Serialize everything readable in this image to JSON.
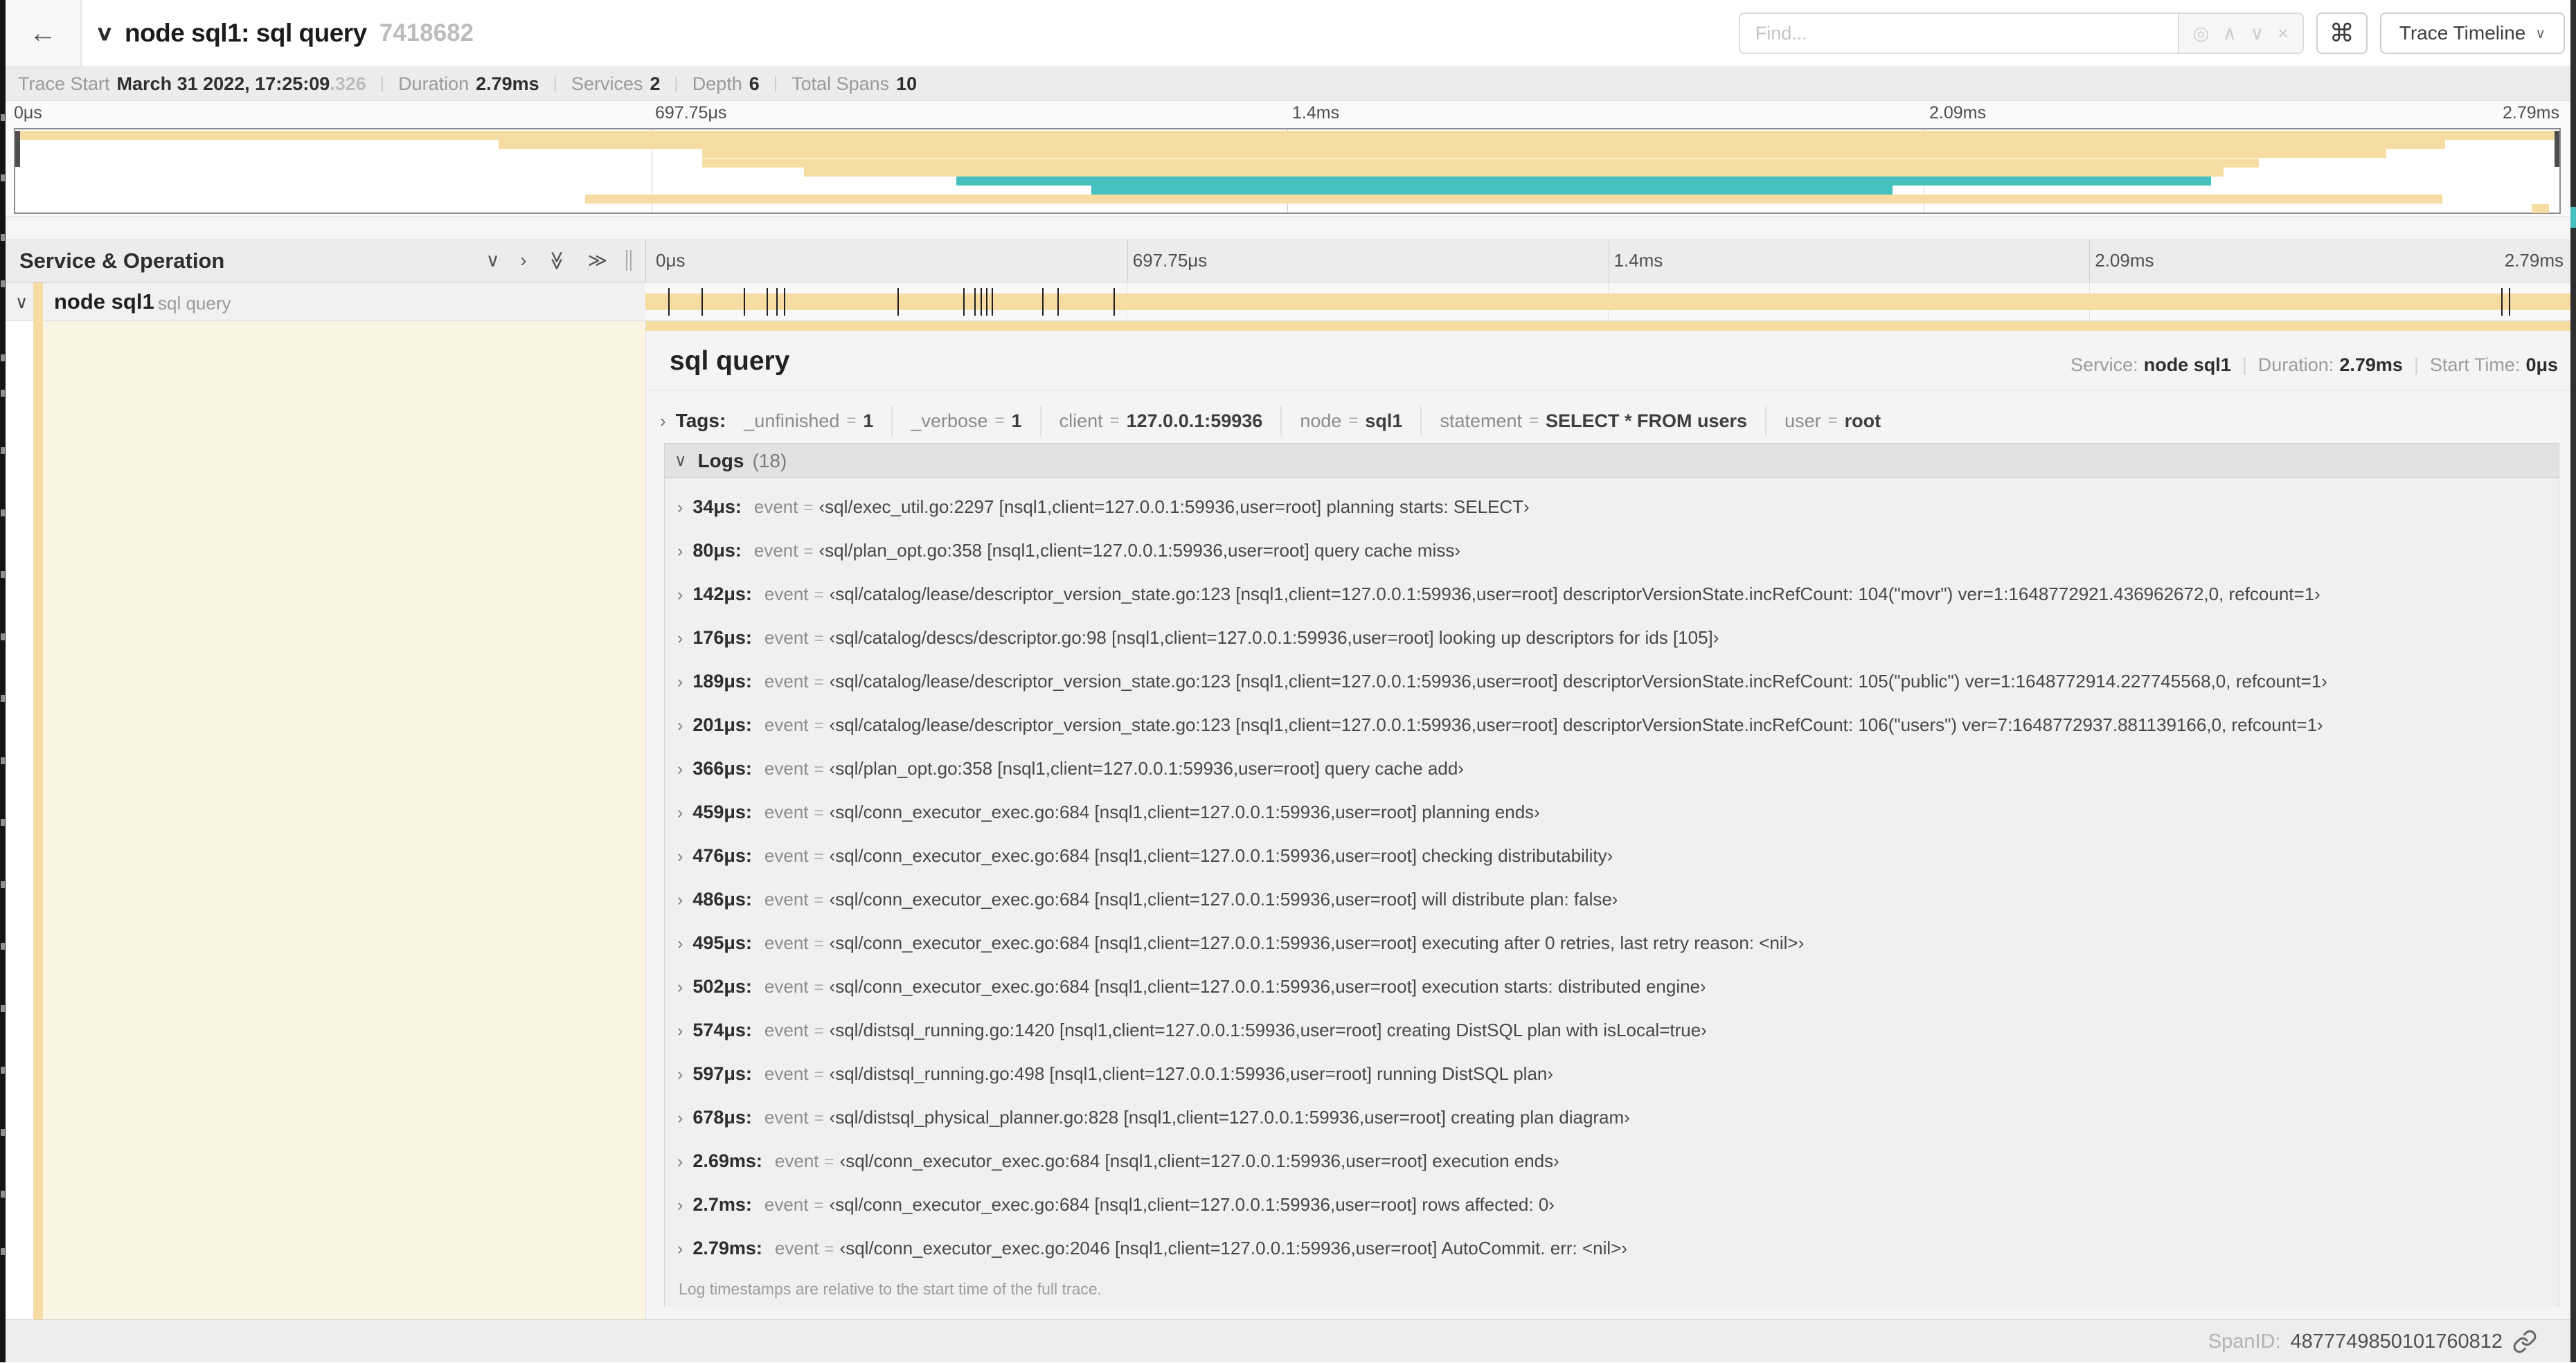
{
  "colors": {
    "span_tan": "#f6dca2",
    "span_teal": "#45bfbf",
    "detail_cream": "#fbf4e2",
    "tick_black": "#1f1f1f"
  },
  "header": {
    "back_label": "←",
    "collapse_caret": "∨",
    "title": "node sql1: sql query",
    "trace_id": "7418682",
    "find_placeholder": "Find...",
    "find_buttons": {
      "scope": "◎",
      "prev": "∧",
      "next": "∨",
      "clear": "×"
    },
    "shortcut_button": "⌘",
    "view_button_label": "Trace Timeline",
    "view_button_caret": "∨"
  },
  "trace_info": {
    "trace_start_label": "Trace Start",
    "trace_start_value": "March 31 2022, 17:25:09",
    "trace_start_ms": ".326",
    "duration_label": "Duration",
    "duration_value": "2.79ms",
    "services_label": "Services",
    "services_value": "2",
    "depth_label": "Depth",
    "depth_value": "6",
    "total_spans_label": "Total Spans",
    "total_spans_value": "10",
    "separator": "|"
  },
  "chart_data": {
    "type": "timeline-minimap",
    "title": "trace span minimap",
    "total_duration": "2.79ms",
    "axis_ticks": [
      {
        "label": "0μs",
        "pct": 0
      },
      {
        "label": "697.75μs",
        "pct": 25
      },
      {
        "label": "1.4ms",
        "pct": 50
      },
      {
        "label": "2.09ms",
        "pct": 75
      },
      {
        "label": "2.79ms",
        "pct": 100
      }
    ],
    "spans": [
      {
        "row": 0,
        "start": 0,
        "end": 100,
        "color": "tan"
      },
      {
        "row": 1,
        "start": 19,
        "end": 95.5,
        "color": "tan"
      },
      {
        "row": 2,
        "start": 27,
        "end": 93.2,
        "color": "tan"
      },
      {
        "row": 3,
        "start": 27,
        "end": 88.2,
        "color": "tan"
      },
      {
        "row": 4,
        "start": 31,
        "end": 86.8,
        "color": "tan"
      },
      {
        "row": 5,
        "start": 37,
        "end": 86.3,
        "color": "teal"
      },
      {
        "row": 6,
        "start": 42.3,
        "end": 73.8,
        "color": "teal"
      },
      {
        "row": 7,
        "start": 22.4,
        "end": 95.4,
        "color": "tan"
      },
      {
        "row": 8,
        "start": 98.9,
        "end": 99.6,
        "color": "tan"
      }
    ]
  },
  "timeline_header": {
    "service_operation_label": "Service & Operation",
    "collapse_icons": {
      "collapse_one": "∨",
      "expand_one": "›",
      "collapse_all": "≫",
      "expand_all": "≫"
    }
  },
  "span_row": {
    "caret": "∨",
    "service": "node sql1",
    "operation": "sql query",
    "bar_start_pct": 0,
    "bar_end_pct": 100,
    "log_tick_pcts": [
      1.2,
      2.9,
      5.1,
      6.3,
      6.8,
      7.2,
      13.1,
      16.5,
      17.1,
      17.4,
      17.7,
      18.0,
      20.6,
      21.4,
      24.3,
      96.4,
      96.8
    ]
  },
  "left_scroll_ticks_pct": [
    8.4,
    12.8,
    17.2,
    20.6,
    26.0,
    28.6,
    32.8,
    37.4,
    41.9,
    46.5,
    51.0,
    55.6,
    60.1,
    64.7,
    69.2,
    73.8,
    78.3,
    82.9,
    87.4,
    91.6
  ],
  "right_strip_teal_segment": {
    "top_pct": 15.2,
    "height_pct": 1.5
  },
  "detail": {
    "title": "sql query",
    "service_label": "Service:",
    "service_value": "node sql1",
    "duration_label": "Duration:",
    "duration_value": "2.79ms",
    "start_time_label": "Start Time:",
    "start_time_value": "0μs",
    "meta_separator": "|",
    "tags_caret": "›",
    "tags_title": "Tags:",
    "equals": "=",
    "tags": [
      {
        "key": "_unfinished",
        "value": "1"
      },
      {
        "key": "_verbose",
        "value": "1"
      },
      {
        "key": "client",
        "value": "127.0.0.1:59936"
      },
      {
        "key": "node",
        "value": "sql1"
      },
      {
        "key": "statement",
        "value": "SELECT * FROM users"
      },
      {
        "key": "user",
        "value": "root"
      }
    ],
    "logs": {
      "caret": "∨",
      "title": "Logs",
      "count_label": "(18)",
      "row_caret": "›",
      "note": "Log timestamps are relative to the start time of the full trace.",
      "rows": [
        {
          "time": "34μs",
          "key": "event",
          "value": "‹sql/exec_util.go:2297 [nsql1,client=127.0.0.1:59936,user=root] planning starts: SELECT›"
        },
        {
          "time": "80μs",
          "key": "event",
          "value": "‹sql/plan_opt.go:358 [nsql1,client=127.0.0.1:59936,user=root] query cache miss›"
        },
        {
          "time": "142μs",
          "key": "event",
          "value": "‹sql/catalog/lease/descriptor_version_state.go:123 [nsql1,client=127.0.0.1:59936,user=root] descriptorVersionState.incRefCount: 104(\"movr\") ver=1:1648772921.436962672,0, refcount=1›"
        },
        {
          "time": "176μs",
          "key": "event",
          "value": "‹sql/catalog/descs/descriptor.go:98 [nsql1,client=127.0.0.1:59936,user=root] looking up descriptors for ids [105]›"
        },
        {
          "time": "189μs",
          "key": "event",
          "value": "‹sql/catalog/lease/descriptor_version_state.go:123 [nsql1,client=127.0.0.1:59936,user=root] descriptorVersionState.incRefCount: 105(\"public\") ver=1:1648772914.227745568,0, refcount=1›"
        },
        {
          "time": "201μs",
          "key": "event",
          "value": "‹sql/catalog/lease/descriptor_version_state.go:123 [nsql1,client=127.0.0.1:59936,user=root] descriptorVersionState.incRefCount: 106(\"users\") ver=7:1648772937.881139166,0, refcount=1›"
        },
        {
          "time": "366μs",
          "key": "event",
          "value": "‹sql/plan_opt.go:358 [nsql1,client=127.0.0.1:59936,user=root] query cache add›"
        },
        {
          "time": "459μs",
          "key": "event",
          "value": "‹sql/conn_executor_exec.go:684 [nsql1,client=127.0.0.1:59936,user=root] planning ends›"
        },
        {
          "time": "476μs",
          "key": "event",
          "value": "‹sql/conn_executor_exec.go:684 [nsql1,client=127.0.0.1:59936,user=root] checking distributability›"
        },
        {
          "time": "486μs",
          "key": "event",
          "value": "‹sql/conn_executor_exec.go:684 [nsql1,client=127.0.0.1:59936,user=root] will distribute plan: false›"
        },
        {
          "time": "495μs",
          "key": "event",
          "value": "‹sql/conn_executor_exec.go:684 [nsql1,client=127.0.0.1:59936,user=root] executing after 0 retries, last retry reason: <nil>›"
        },
        {
          "time": "502μs",
          "key": "event",
          "value": "‹sql/conn_executor_exec.go:684 [nsql1,client=127.0.0.1:59936,user=root] execution starts: distributed engine›"
        },
        {
          "time": "574μs",
          "key": "event",
          "value": "‹sql/distsql_running.go:1420 [nsql1,client=127.0.0.1:59936,user=root] creating DistSQL plan with isLocal=true›"
        },
        {
          "time": "597μs",
          "key": "event",
          "value": "‹sql/distsql_running.go:498 [nsql1,client=127.0.0.1:59936,user=root] running DistSQL plan›"
        },
        {
          "time": "678μs",
          "key": "event",
          "value": "‹sql/distsql_physical_planner.go:828 [nsql1,client=127.0.0.1:59936,user=root] creating plan diagram›"
        },
        {
          "time": "2.69ms",
          "key": "event",
          "value": "‹sql/conn_executor_exec.go:684 [nsql1,client=127.0.0.1:59936,user=root] execution ends›"
        },
        {
          "time": "2.7ms",
          "key": "event",
          "value": "‹sql/conn_executor_exec.go:684 [nsql1,client=127.0.0.1:59936,user=root] rows affected: 0›"
        },
        {
          "time": "2.79ms",
          "key": "event",
          "value": "‹sql/conn_executor_exec.go:2046 [nsql1,client=127.0.0.1:59936,user=root] AutoCommit. err: <nil>›"
        }
      ]
    },
    "footer": {
      "span_id_label": "SpanID:",
      "span_id_value": "4877749850101760812"
    }
  }
}
